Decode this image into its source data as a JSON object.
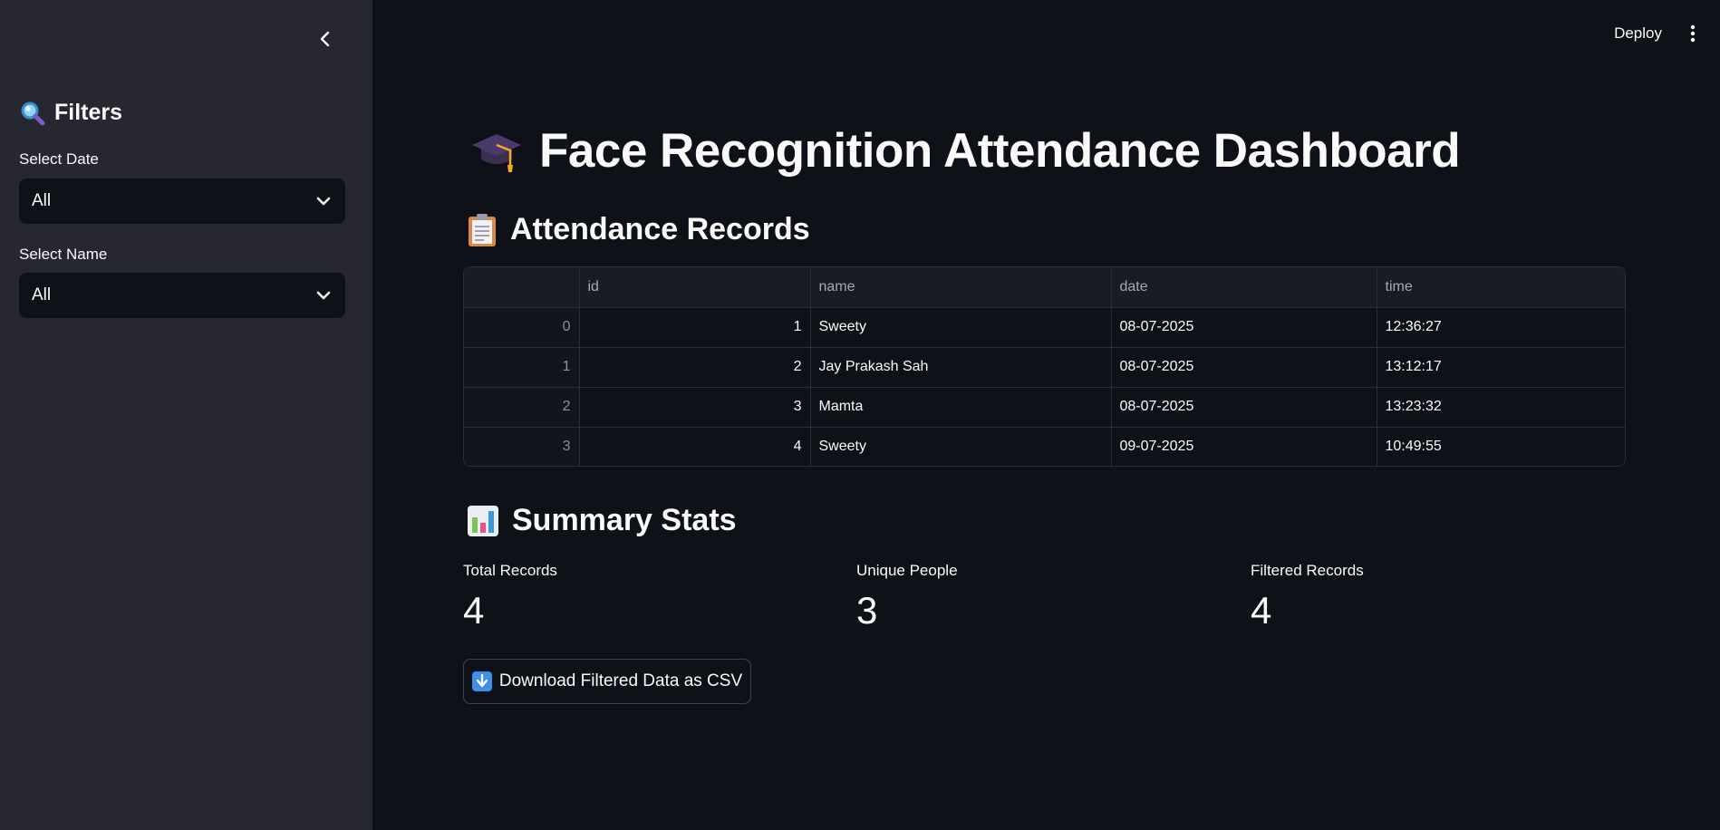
{
  "sidebar": {
    "header": "Filters",
    "header_icon": "magnifier-icon",
    "date_label": "Select Date",
    "date_value": "All",
    "name_label": "Select Name",
    "name_value": "All"
  },
  "toolbar": {
    "deploy_label": "Deploy"
  },
  "main": {
    "title": "Face Recognition Attendance Dashboard",
    "title_icon": "graduation-cap-icon",
    "records_heading": "Attendance Records",
    "records_icon": "clipboard-icon",
    "stats_heading": "Summary Stats",
    "stats_icon": "bar-chart-icon"
  },
  "table": {
    "columns": [
      "",
      "id",
      "name",
      "date",
      "time"
    ],
    "rows": [
      {
        "index": "0",
        "id": "1",
        "name": "Sweety",
        "date": "08-07-2025",
        "time": "12:36:27"
      },
      {
        "index": "1",
        "id": "2",
        "name": "Jay Prakash Sah",
        "date": "08-07-2025",
        "time": "13:12:17"
      },
      {
        "index": "2",
        "id": "3",
        "name": "Mamta",
        "date": "08-07-2025",
        "time": "13:23:32"
      },
      {
        "index": "3",
        "id": "4",
        "name": "Sweety",
        "date": "09-07-2025",
        "time": "10:49:55"
      }
    ]
  },
  "metrics": [
    {
      "label": "Total Records",
      "value": "4"
    },
    {
      "label": "Unique People",
      "value": "3"
    },
    {
      "label": "Filtered Records",
      "value": "4"
    }
  ],
  "download": {
    "label": "Download Filtered Data as CSV",
    "icon": "down-arrow-icon"
  },
  "colors": {
    "app_bg": "#0e1117",
    "sidebar_bg": "#262730",
    "border": "#2b2e37"
  }
}
